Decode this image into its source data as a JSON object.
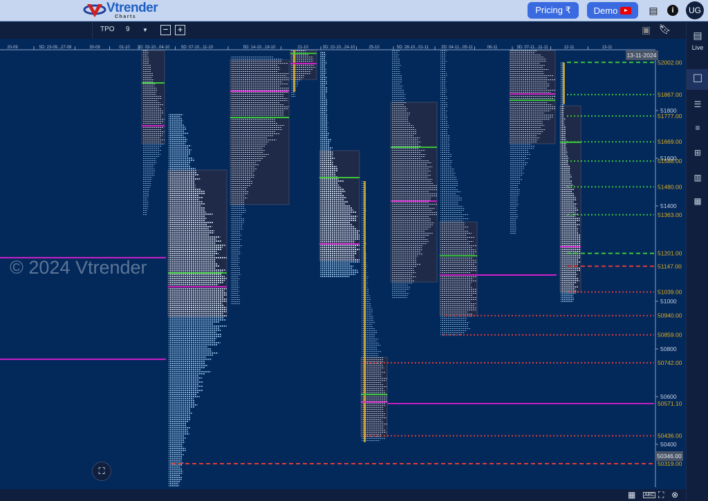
{
  "header": {
    "logo_text": "Vtrender",
    "logo_sub": "Charts",
    "pricing_label": "Pricing ₹",
    "demo_label": "Demo",
    "avatar": "UG",
    "icons": [
      "document-icon",
      "info-icon"
    ]
  },
  "toolbar": {
    "tpo_label": "TPO",
    "tpo_value": "9",
    "minus": "−",
    "plus": "+"
  },
  "sidebar": {
    "live_label": "Live"
  },
  "watermark": "© 2024 Vtrender",
  "colors": {
    "background": "#03285a",
    "value_area_box": "#1f2a48",
    "poc": "#d020c8",
    "green_level": "#3cc83c",
    "red_level": "#e03c3c",
    "price_label": "#e0b020"
  },
  "chart_data": {
    "type": "market-profile (TPO)",
    "cursor_date": "13-11-2024",
    "cursor_price": "50346.00",
    "date_labels": [
      "20-09",
      "5D: 23-09...27-09",
      "30-09",
      "01-10",
      "3D: 03-10...04-10",
      "5D: 07-10...11-10",
      "5D: 14-10...18-10",
      "21-10",
      "3D: 22-10...24-10",
      "25-10",
      "5D: 28-10...01-11",
      "2D: 04-11...05-11",
      "06-11",
      "3D: 07-11...11-11",
      "12-11",
      "13-11"
    ],
    "price_ticks": [
      51800,
      51600,
      51400,
      51000,
      50800,
      50600,
      50400
    ],
    "ylim": [
      50226,
      52100
    ],
    "profiles": [
      {
        "label": "3D: 03-10...04-10",
        "high": 52052,
        "low": 51365,
        "vah": 52052,
        "val": 51661,
        "poc": 51736,
        "green": 51916
      },
      {
        "label": "5D: 07-10...11-10",
        "high": 51786,
        "low": 50226,
        "vah": 51551,
        "val": 50936,
        "poc": 51061,
        "green": 51119
      },
      {
        "label": "5D: 14-10...18-10",
        "high": 52026,
        "low": 50988,
        "vah": 52012,
        "val": 51406,
        "poc": 51881,
        "green": 51771
      },
      {
        "label": "21-10",
        "high": 52052,
        "low": 51858,
        "vah": 52052,
        "val": 51930,
        "poc": 51997,
        "green": 52040
      },
      {
        "label": "3D: 22-10...24-10",
        "high": 52046,
        "low": 51099,
        "vah": 51632,
        "val": 51171,
        "poc": 51241,
        "green": 51519
      },
      {
        "label": "25-10",
        "high": 51504,
        "low": 50409,
        "vah": 50765,
        "val": 50432,
        "poc": 50577,
        "green": 50609
      },
      {
        "label": "5D: 28-10...01-11",
        "high": 52052,
        "low": 51012,
        "vah": 51835,
        "val": 51081,
        "poc": 51420,
        "green": 51646
      },
      {
        "label": "2D: 04-11...05-11",
        "high": 52052,
        "low": 50858,
        "vah": 51333,
        "val": 50939,
        "poc": 51110,
        "green": 51191
      },
      {
        "label": "3D: 07-11...11-11",
        "high": 52052,
        "low": 51284,
        "vah": 52052,
        "val": 51661,
        "poc": 51870,
        "green": 51843
      },
      {
        "label": "12-11",
        "high": 52002,
        "low": 51000,
        "vah": 51820,
        "val": 51038,
        "poc": 51229,
        "green": 51667
      }
    ],
    "extended_poc_lines": [
      51183,
      50757,
      51110
    ],
    "levels": [
      {
        "price": 52002,
        "label": "52002.00",
        "color": "green",
        "style": "dashed"
      },
      {
        "price": 51867,
        "label": "51867.00",
        "color": "green",
        "style": "dotted"
      },
      {
        "price": 51777,
        "label": "51777.00",
        "color": "green",
        "style": "dotted"
      },
      {
        "price": 51669,
        "label": "51669.00",
        "color": "green",
        "style": "dotted"
      },
      {
        "price": 51588,
        "label": "51588.00",
        "color": "green",
        "style": "dotted"
      },
      {
        "price": 51480,
        "label": "51480.00",
        "color": "green",
        "style": "dotted"
      },
      {
        "price": 51363,
        "label": "51363.00",
        "color": "green",
        "style": "dotted"
      },
      {
        "price": 51201,
        "label": "51201.00",
        "color": "green",
        "style": "dashed"
      },
      {
        "price": 51147,
        "label": "51147.00",
        "color": "red",
        "style": "dashed"
      },
      {
        "price": 51039,
        "label": "51039.00",
        "color": "red",
        "style": "dotted"
      },
      {
        "price": 50940,
        "label": "50940.00",
        "color": "red",
        "style": "dotted"
      },
      {
        "price": 50859,
        "label": "50859.00",
        "color": "red",
        "style": "dotted"
      },
      {
        "price": 50742,
        "label": "50742.00",
        "color": "red",
        "style": "dotted"
      },
      {
        "price": 50571.1,
        "label": "50571.10",
        "color": "magenta",
        "style": "solid"
      },
      {
        "price": 50436,
        "label": "50436.00",
        "color": "red",
        "style": "dotted"
      },
      {
        "price": 50319,
        "label": "50319.00",
        "color": "red",
        "style": "dashed"
      }
    ]
  }
}
